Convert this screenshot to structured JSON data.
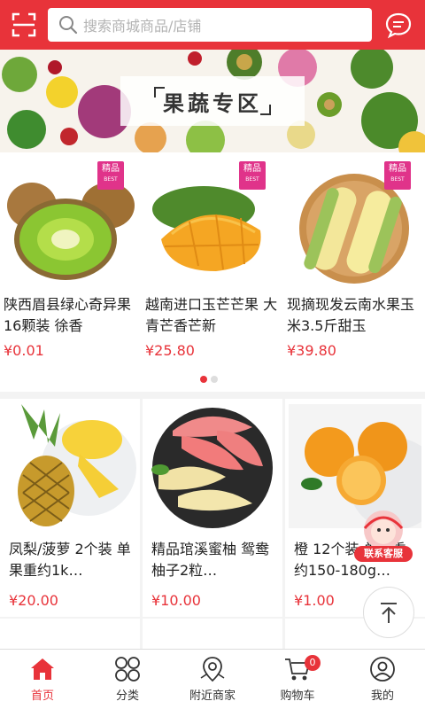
{
  "header": {
    "search_placeholder": "搜索商城商品/店铺",
    "scan_icon": "scan-icon",
    "message_icon": "message-icon"
  },
  "banner": {
    "title": "果蔬专区"
  },
  "featured": [
    {
      "name": "陕西眉县绿心奇异果16颗装 徐香",
      "price": "¥0.01",
      "tag": "精品",
      "tag_sub": "BEST"
    },
    {
      "name": "越南进口玉芒芒果 大青芒香芒新",
      "price": "¥25.80",
      "tag": "精品",
      "tag_sub": "BEST"
    },
    {
      "name": "现摘现发云南水果玉米3.5斤甜玉",
      "price": "¥39.80",
      "tag": "精品",
      "tag_sub": "BEST"
    }
  ],
  "carousel": {
    "total": 2,
    "active_index": 0
  },
  "grid": [
    {
      "name": "凤梨/菠萝 2个装 单果重约1k…",
      "price": "¥20.00"
    },
    {
      "name": "精品琯溪蜜柚 鸳鸯柚子2粒…",
      "price": "¥10.00"
    },
    {
      "name": "橙 12个装 单果重约150-180g…",
      "price": "¥1.00"
    }
  ],
  "customer_service": {
    "label": "联系客服"
  },
  "tabbar": [
    {
      "label": "首页",
      "icon": "home-icon",
      "active": true
    },
    {
      "label": "分类",
      "icon": "category-icon",
      "active": false
    },
    {
      "label": "附近商家",
      "icon": "location-icon",
      "active": false
    },
    {
      "label": "购物车",
      "icon": "cart-icon",
      "active": false,
      "badge": "0"
    },
    {
      "label": "我的",
      "icon": "user-icon",
      "active": false
    }
  ],
  "colors": {
    "brand": "#e8333a",
    "tag": "#e0338a"
  }
}
